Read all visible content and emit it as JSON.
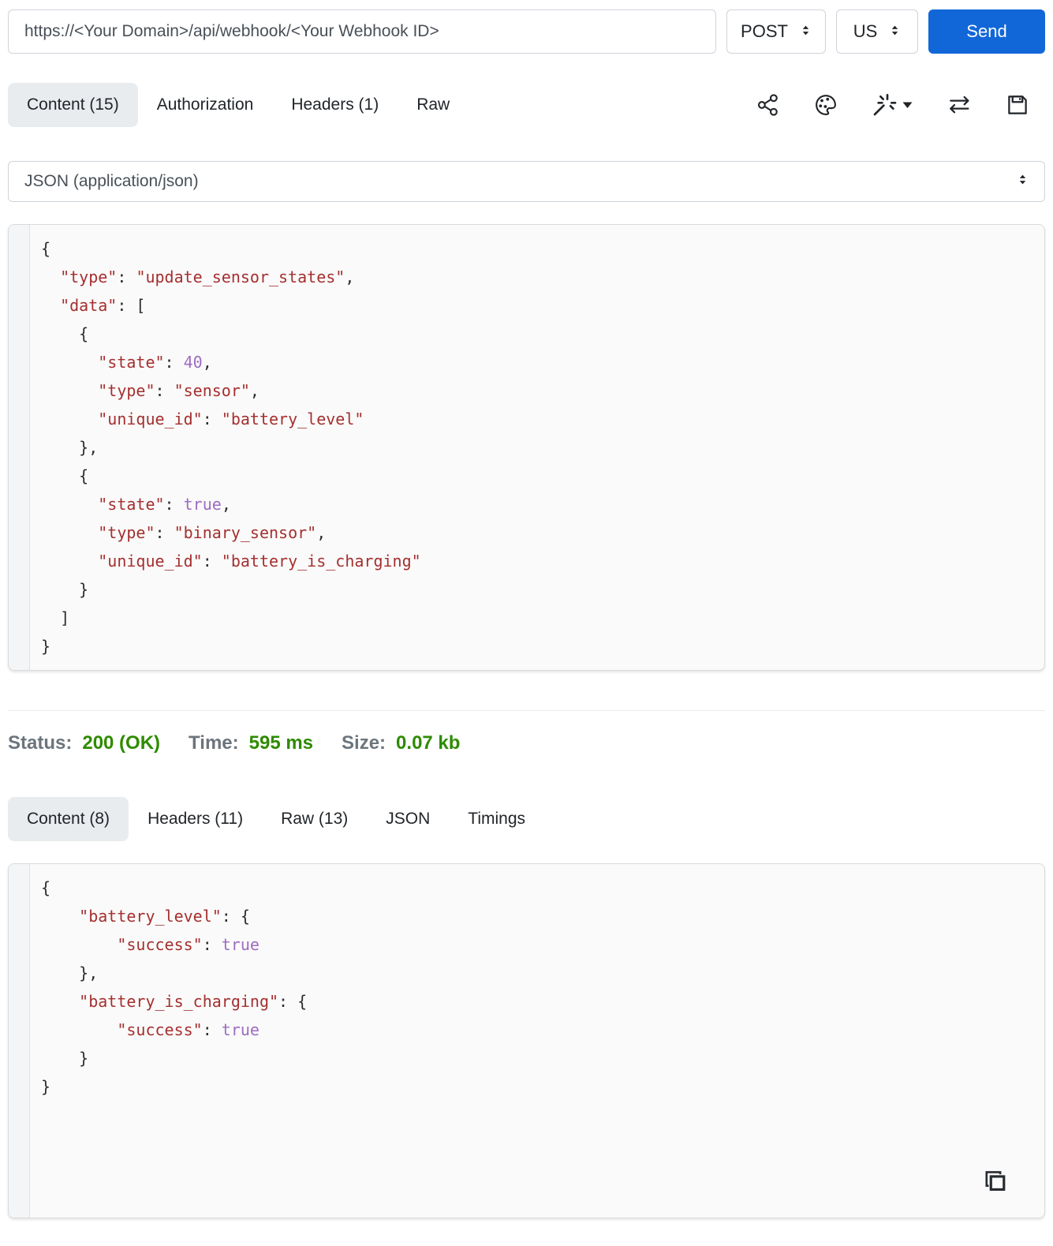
{
  "colors": {
    "accent_blue": "#1267d8",
    "status_green": "#2e8b00",
    "label_gray": "#6c757d",
    "token_string_red": "#a52f2f",
    "token_literal_purple": "#9d6cc2",
    "active_tab_bg": "#e9ecef"
  },
  "request": {
    "url": "https://<Your Domain>/api/webhook/<Your Webhook ID>",
    "method": "POST",
    "region": "US",
    "send_label": "Send",
    "tabs": [
      {
        "label": "Content (15)",
        "active": true
      },
      {
        "label": "Authorization",
        "active": false
      },
      {
        "label": "Headers (1)",
        "active": false
      },
      {
        "label": "Raw",
        "active": false
      }
    ],
    "toolbar_icons": [
      {
        "name": "share-icon"
      },
      {
        "name": "palette-icon"
      },
      {
        "name": "magic-wand-icon",
        "has_caret": true
      },
      {
        "name": "swap-arrows-icon"
      },
      {
        "name": "save-icon"
      }
    ],
    "content_type": "JSON (application/json)",
    "body_lines": [
      "{",
      "  \"type\": \"update_sensor_states\",",
      "  \"data\": [",
      "    {",
      "      \"state\": 40,",
      "      \"type\": \"sensor\",",
      "      \"unique_id\": \"battery_level\"",
      "    },",
      "    {",
      "      \"state\": true,",
      "      \"type\": \"binary_sensor\",",
      "      \"unique_id\": \"battery_is_charging\"",
      "    }",
      "  ]",
      "}"
    ]
  },
  "response": {
    "status_label": "Status:",
    "status_value": "200 (OK)",
    "time_label": "Time:",
    "time_value": "595 ms",
    "size_label": "Size:",
    "size_value": "0.07 kb",
    "tabs": [
      {
        "label": "Content (8)",
        "active": true
      },
      {
        "label": "Headers (11)",
        "active": false
      },
      {
        "label": "Raw (13)",
        "active": false
      },
      {
        "label": "JSON",
        "active": false
      },
      {
        "label": "Timings",
        "active": false
      }
    ],
    "copy_icon": "copy-icon",
    "body_lines": [
      "{",
      "    \"battery_level\": {",
      "        \"success\": true",
      "    },",
      "    \"battery_is_charging\": {",
      "        \"success\": true",
      "    }",
      "}"
    ]
  }
}
